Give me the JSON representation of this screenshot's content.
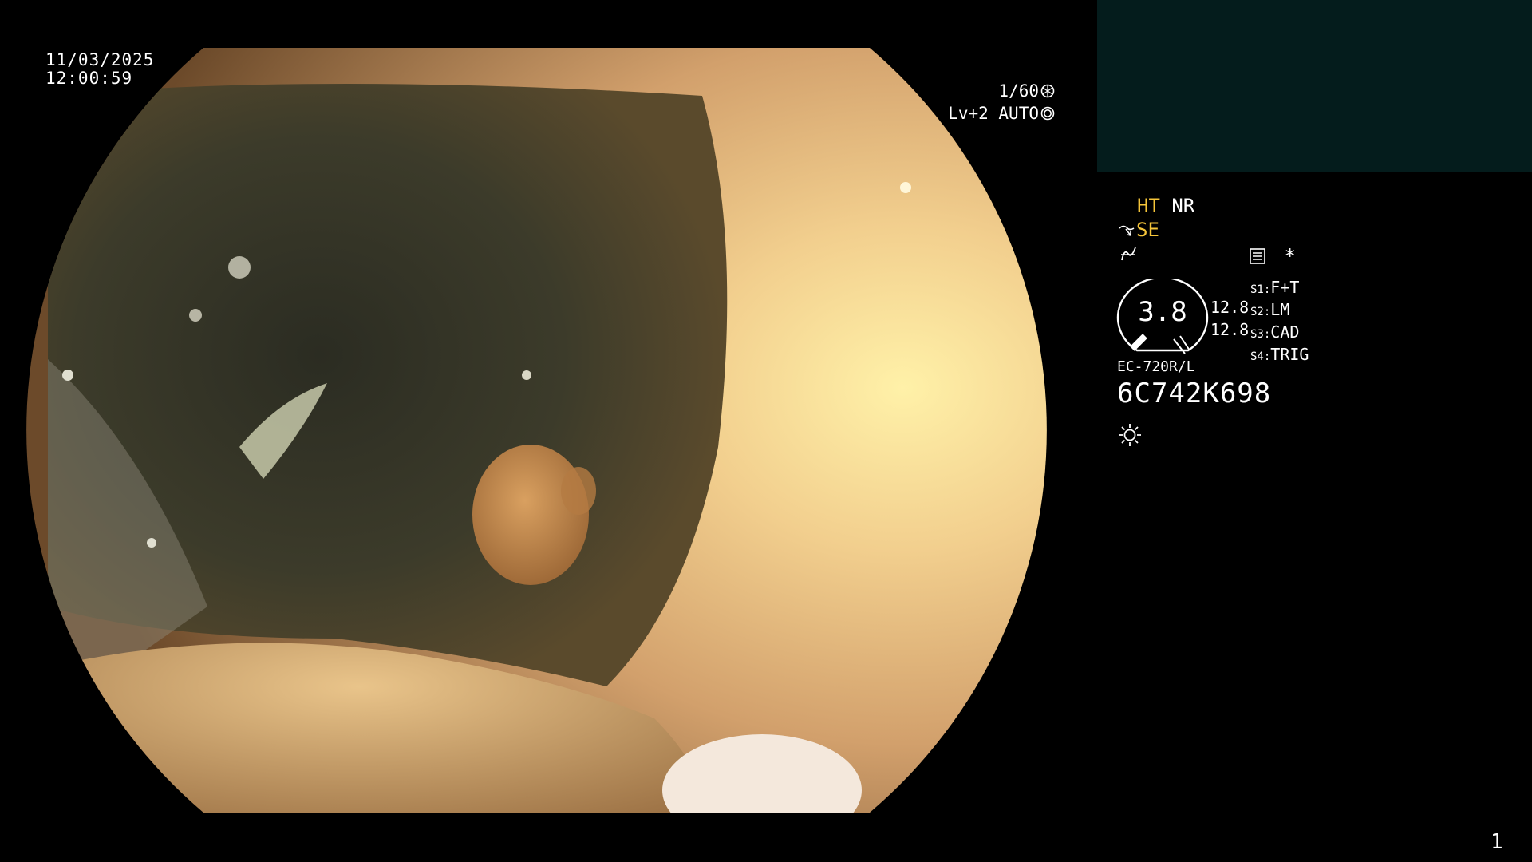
{
  "overlay": {
    "date": "11/03/2025",
    "time": "12:00:59",
    "shutter": "1/60",
    "shutter_icon": "shutter-icon",
    "level": "Lv+2 AUTO",
    "level_icon": "iris-icon"
  },
  "panel": {
    "thumb_color": "#041c1c",
    "mode_ht": "HT",
    "mode_nr": "NR",
    "mode_se": "SE",
    "se_icon": "wave-arrow-icon",
    "enhance_icon": "curve-icon",
    "memo_icon": "memo-icon",
    "asterisk": "*",
    "gauge_value": "3.8",
    "val_top": "12.8",
    "val_bottom": "12.8",
    "settings": [
      {
        "key": "S1:",
        "value": "F+T"
      },
      {
        "key": "S2:",
        "value": "LM"
      },
      {
        "key": "S3:",
        "value": "CAD"
      },
      {
        "key": "S4:",
        "value": "TRIG"
      }
    ],
    "model": "EC-720R/L",
    "serial": "6C742K698",
    "light_icon": "sun-icon"
  },
  "page_number": "1",
  "colors": {
    "background": "#000000",
    "accent_yellow": "#f5c53a",
    "text": "#ffffff"
  }
}
